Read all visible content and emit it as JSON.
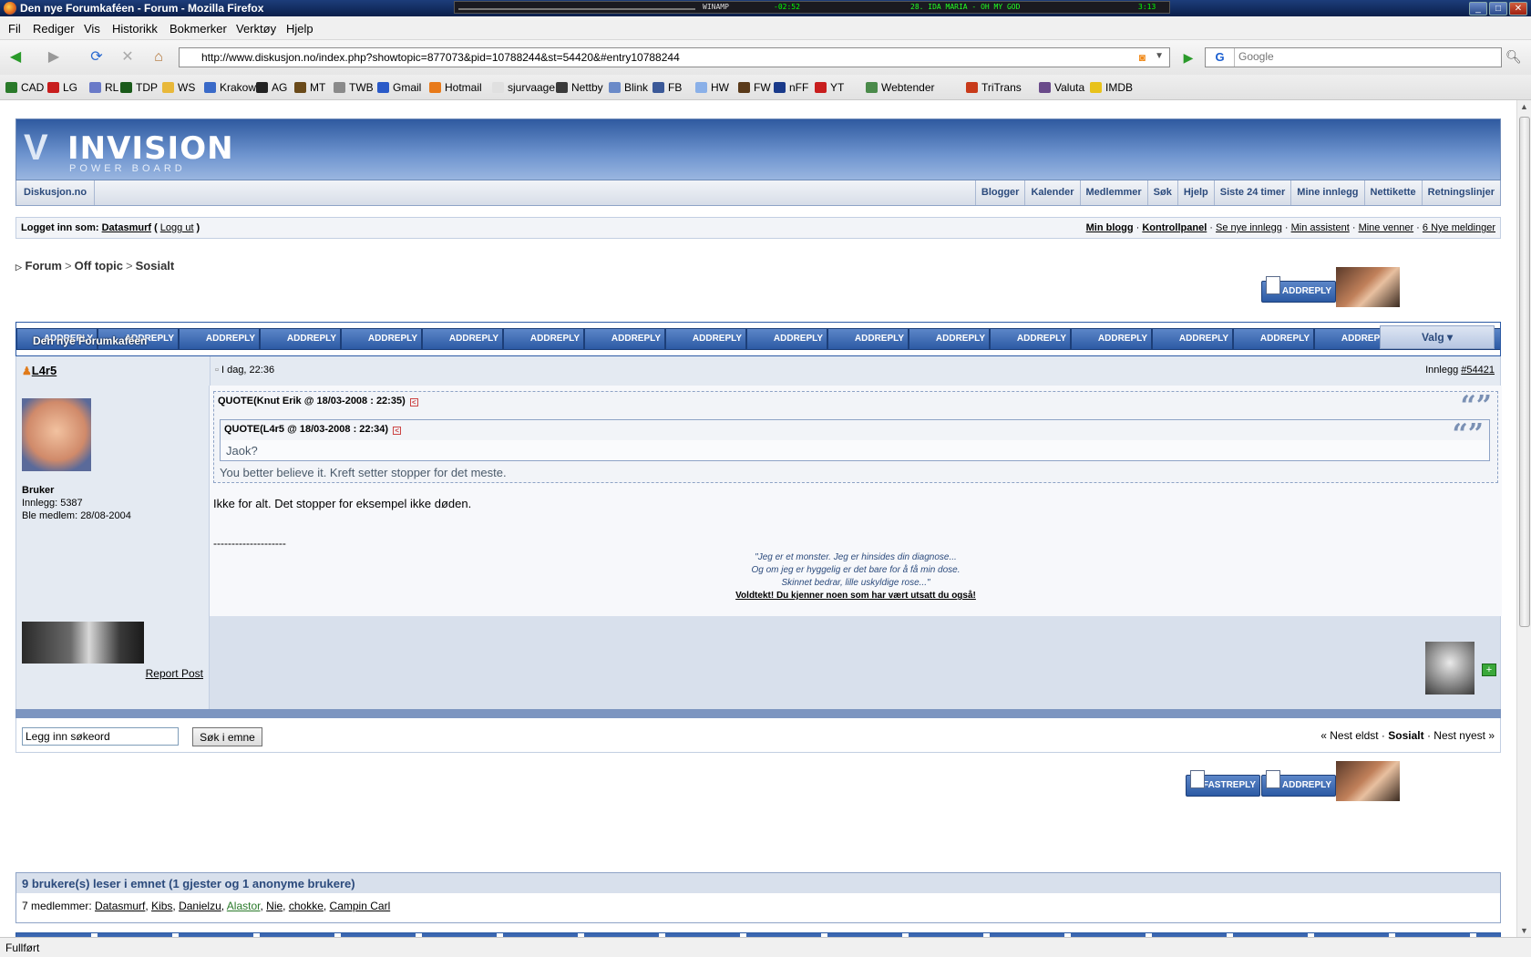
{
  "window": {
    "title": "Den nye Forumkaféen - Forum - Mozilla Firefox",
    "winamp_label": "WINAMP",
    "winamp_time": "-02:52",
    "winamp_track": "28. IDA MARIA - OH MY GOD",
    "winamp_length": "3:13"
  },
  "menu": [
    "Fil",
    "Rediger",
    "Vis",
    "Historikk",
    "Bokmerker",
    "Verktøy",
    "Hjelp"
  ],
  "address": {
    "url": "http://www.diskusjon.no/index.php?showtopic=877073&pid=10788244&st=54420&#entry10788244",
    "search_placeholder": "Google"
  },
  "bookmarks": [
    {
      "label": "CAD",
      "color": "#2a7a2a"
    },
    {
      "label": "LG",
      "color": "#c81e1e"
    },
    {
      "label": "RL",
      "color": "#6a7ac8"
    },
    {
      "label": "TDP",
      "color": "#1a5a1a"
    },
    {
      "label": "WS",
      "color": "#e8b83a"
    },
    {
      "label": "Krakow",
      "color": "#3a6ac8"
    },
    {
      "label": "AG",
      "color": "#222222"
    },
    {
      "label": "MT",
      "color": "#6a4a1a"
    },
    {
      "label": "TWB",
      "color": "#8a8a8a"
    },
    {
      "label": "Gmail",
      "color": "#2a5ac8"
    },
    {
      "label": "Hotmail",
      "color": "#e87a1a"
    },
    {
      "label": "sjurvaage",
      "color": "#e0e0e0"
    },
    {
      "label": "Nettby",
      "color": "#3a3a3a"
    },
    {
      "label": "Blink",
      "color": "#6a8ac8"
    },
    {
      "label": "FB",
      "color": "#3b5998"
    },
    {
      "label": "HW",
      "color": "#8ab0e8"
    },
    {
      "label": "FW",
      "color": "#5a3a1a"
    },
    {
      "label": "nFF",
      "color": "#1a3a8a"
    },
    {
      "label": "YT",
      "color": "#c81e1e"
    },
    {
      "label": "Webtender",
      "color": "#4a8a4a"
    },
    {
      "label": "TriTrans",
      "color": "#c83a1a"
    },
    {
      "label": "Valuta",
      "color": "#6a4a8a"
    },
    {
      "label": "IMDB",
      "color": "#e8c21a"
    }
  ],
  "forum": {
    "logo_main": "INVISION",
    "logo_sub": "POWER BOARD",
    "home_link": "Diskusjon.no",
    "nav_links": [
      "Blogger",
      "Kalender",
      "Medlemmer",
      "Søk",
      "Hjelp",
      "Siste 24 timer",
      "Mine innlegg",
      "Nettikette",
      "Retningslinjer"
    ],
    "logged_in_prefix": "Logget inn som:",
    "username": "Datasmurf",
    "logout": "Logg ut",
    "user_links": [
      "Min blogg",
      "Kontrollpanel",
      "Se nye innlegg",
      "Min assistent",
      "Mine venner",
      "6 Nye meldinger"
    ],
    "breadcrumb": [
      "Forum",
      "Off topic",
      "Sosialt"
    ],
    "add_reply": "ADDREPLY",
    "fast_reply": "FASTREPLY",
    "topic_title": "Den nye Forumkaféen",
    "valg": "Valg ▾"
  },
  "post": {
    "author": "L4r5",
    "date": "I dag, 22:36",
    "post_label": "Innlegg",
    "post_number": "#54421",
    "user_group": "Bruker",
    "post_count": "Innlegg: 5387",
    "member_since": "Ble medlem: 28/08-2004",
    "quote_outer_header": "QUOTE(Knut Erik @ 18/03-2008 : 22:35)",
    "quote_inner_header": "QUOTE(L4r5 @ 18/03-2008 : 22:34)",
    "quote_inner_text": "Jaok?",
    "quote_outer_text": "You better believe it. Kreft setter stopper for det meste.",
    "reply_text": "Ikke for alt. Det stopper for eksempel ikke døden.",
    "sig_separator": "--------------------",
    "sig_line1": "\"Jeg er et monster. Jeg er hinsides din diagnose...",
    "sig_line2": "Og om jeg er hyggelig er det bare for å få min dose.",
    "sig_line3": "Skinnet bedrar, lille uskyldige rose...\"",
    "sig_link": "Voldtekt! Du kjenner noen som har vært utsatt du også!",
    "report": "Report Post"
  },
  "search": {
    "input_value": "Legg inn søkeord",
    "button": "Søk i emne",
    "prev": "« Nest eldst",
    "current": "Sosialt",
    "next": "Nest nyest »"
  },
  "readers": {
    "header": "9 brukere(s) leser i emnet (1 gjester og 1 anonyme brukere)",
    "members_label": "7 medlemmer:",
    "members": [
      "Datasmurf",
      "Kibs",
      "Danielzu",
      "Alastor",
      "Nie",
      "chokke",
      "Campin Carl"
    ]
  },
  "status": "Fullført"
}
